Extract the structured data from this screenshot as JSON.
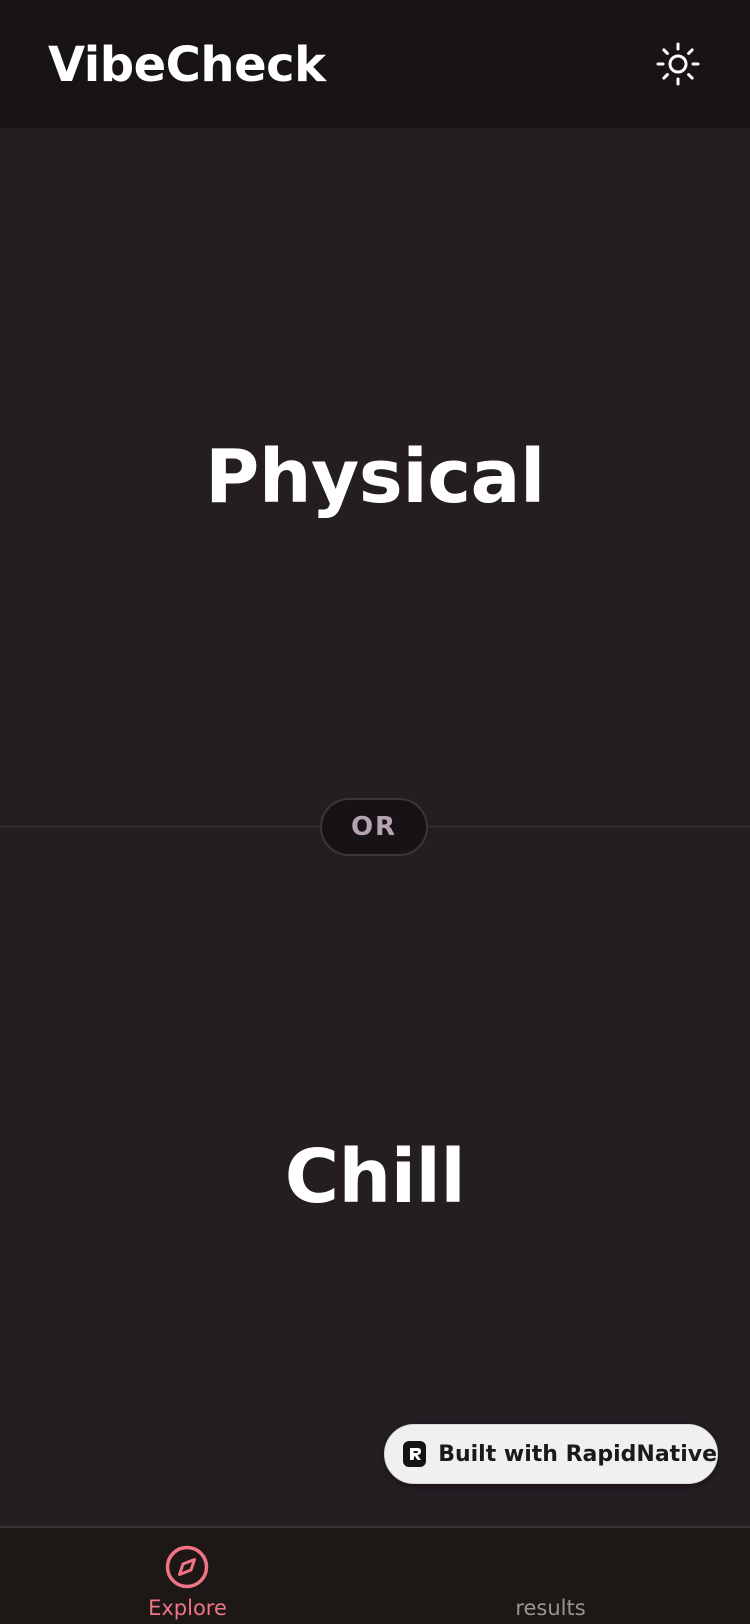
{
  "header": {
    "title": "VibeCheck",
    "theme_icon": "sun-icon"
  },
  "options": {
    "first": "Physical",
    "second": "Chill",
    "separator": "OR"
  },
  "badge": {
    "text": "Built with RapidNative",
    "icon": "rapidnative-logo-icon"
  },
  "tabs": [
    {
      "label": "Explore",
      "icon": "compass-icon",
      "active": true
    },
    {
      "label": "results",
      "icon": "",
      "active": false
    }
  ],
  "colors": {
    "background": "#241d22",
    "header": "#181317",
    "accent": "#f07386",
    "tab_inactive": "#9a9491"
  }
}
